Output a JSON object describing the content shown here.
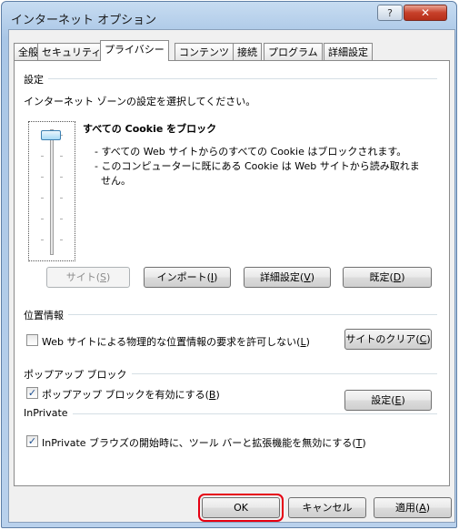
{
  "window": {
    "title": "インターネット オプション",
    "help_label": "?",
    "close_label": "✕"
  },
  "tabs": [
    {
      "label": "全般"
    },
    {
      "label": "セキュリティ"
    },
    {
      "label": "プライバシー",
      "active": true
    },
    {
      "label": "コンテンツ"
    },
    {
      "label": "接続"
    },
    {
      "label": "プログラム"
    },
    {
      "label": "詳細設定"
    }
  ],
  "settings": {
    "heading": "設定",
    "zone_prompt": "インターネット ゾーンの設定を選択してください。",
    "level_title": "すべての Cookie をブロック",
    "level_desc_1": "- すべての Web サイトからのすべての Cookie はブロックされます。",
    "level_desc_2": "- このコンピューターに既にある Cookie は Web サイトから読み取れま",
    "level_desc_3": "せん。",
    "slider_level": 1.0
  },
  "buttons": {
    "sites": {
      "text": "サイト(",
      "key": "S",
      "end": ")"
    },
    "import": {
      "text": "インポート(",
      "key": "I",
      "end": ")"
    },
    "advanced": {
      "text": "詳細設定(",
      "key": "V",
      "end": ")"
    },
    "default": {
      "text": "既定(",
      "key": "D",
      "end": ")"
    },
    "clear_sites": {
      "text": "サイトのクリア(",
      "key": "C",
      "end": ")"
    },
    "popup_settings": {
      "text": "設定(",
      "key": "E",
      "end": ")"
    },
    "ok": "OK",
    "cancel": "キャンセル",
    "apply": {
      "text": "適用(",
      "key": "A",
      "end": ")"
    }
  },
  "location": {
    "heading": "位置情報",
    "checkbox_text": "Web サイトによる物理的な位置情報の要求を許可しない(",
    "checkbox_key": "L",
    "checkbox_end": ")",
    "checked": false
  },
  "popup": {
    "heading": "ポップアップ ブロック",
    "checkbox_text": "ポップアップ ブロックを有効にする(",
    "checkbox_key": "B",
    "checkbox_end": ")",
    "checked": true
  },
  "inprivate": {
    "heading": "InPrivate",
    "checkbox_text": "InPrivate ブラウズの開始時に、ツール バーと拡張機能を無効にする(",
    "checkbox_key": "T",
    "checkbox_end": ")",
    "checked": true
  },
  "colors": {
    "highlight": "#e60012"
  }
}
